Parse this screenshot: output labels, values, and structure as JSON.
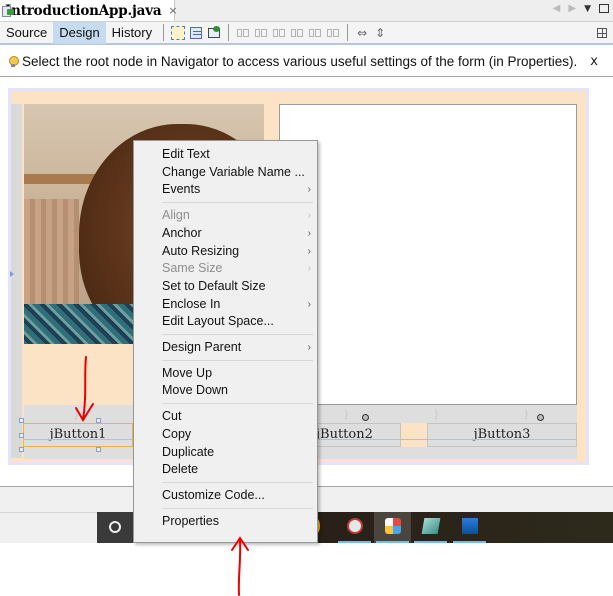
{
  "editor_tab": {
    "filename": "IntroductionApp.java",
    "close_glyph": "×",
    "nav_left": "◀",
    "nav_right": "▶",
    "dropdown": "▼"
  },
  "toolbar": {
    "view_tabs": [
      {
        "label": "Source",
        "active": false
      },
      {
        "label": "Design",
        "active": true
      },
      {
        "label": "History",
        "active": false
      }
    ],
    "icons": [
      "selection-mode-icon",
      "connection-mode-icon",
      "preview-design-icon",
      "align-left-icon",
      "align-right-icon",
      "center-horizontal-icon",
      "align-top-icon",
      "align-bottom-icon",
      "center-vertical-icon",
      "change-horizontal-resizability-icon",
      "change-vertical-resizability-icon"
    ],
    "resize_h_glyph": "⇔",
    "resize_v_glyph": "⇕"
  },
  "hint": {
    "text": "Select the root node in Navigator to access various useful settings of the form (in Properties).",
    "close": "x"
  },
  "form": {
    "buttons": [
      {
        "label": "jButton1",
        "selected": true
      },
      {
        "label": "jButton2",
        "selected": false
      },
      {
        "label": "jButton3",
        "selected": false
      }
    ],
    "gap_glyph": "⟩"
  },
  "context_menu": {
    "items": [
      {
        "label": "Edit Text",
        "enabled": true,
        "submenu": false
      },
      {
        "label": "Change Variable Name ...",
        "enabled": true,
        "submenu": false
      },
      {
        "label": "Events",
        "enabled": true,
        "submenu": true
      },
      {
        "separator": true
      },
      {
        "label": "Align",
        "enabled": false,
        "submenu": true
      },
      {
        "label": "Anchor",
        "enabled": true,
        "submenu": true
      },
      {
        "label": "Auto Resizing",
        "enabled": true,
        "submenu": true
      },
      {
        "label": "Same Size",
        "enabled": false,
        "submenu": true
      },
      {
        "label": "Set to Default Size",
        "enabled": true,
        "submenu": false
      },
      {
        "label": "Enclose In",
        "enabled": true,
        "submenu": true
      },
      {
        "label": "Edit Layout Space...",
        "enabled": true,
        "submenu": false
      },
      {
        "separator": true
      },
      {
        "label": "Design Parent",
        "enabled": true,
        "submenu": true
      },
      {
        "separator": true
      },
      {
        "label": "Move Up",
        "enabled": true,
        "submenu": false
      },
      {
        "label": "Move Down",
        "enabled": true,
        "submenu": false
      },
      {
        "separator": true
      },
      {
        "label": "Cut",
        "enabled": true,
        "submenu": false
      },
      {
        "label": "Copy",
        "enabled": true,
        "submenu": false
      },
      {
        "label": "Duplicate",
        "enabled": true,
        "submenu": false
      },
      {
        "label": "Delete",
        "enabled": true,
        "submenu": false
      },
      {
        "separator": true
      },
      {
        "label": "Customize Code...",
        "enabled": true,
        "submenu": false
      },
      {
        "separator": true
      },
      {
        "label": "Properties",
        "enabled": true,
        "submenu": false
      }
    ],
    "submenu_glyph": "›"
  },
  "taskbar": {
    "apps": [
      "cortana-search",
      "chrome",
      "snipping-tool",
      "netbeans",
      "sticky-notes",
      "photos"
    ],
    "active_app": "netbeans"
  },
  "annotations": {
    "color": "#ee0000",
    "arrows": [
      "arrow-pointing-to-jButton1",
      "arrow-pointing-to-properties"
    ]
  }
}
